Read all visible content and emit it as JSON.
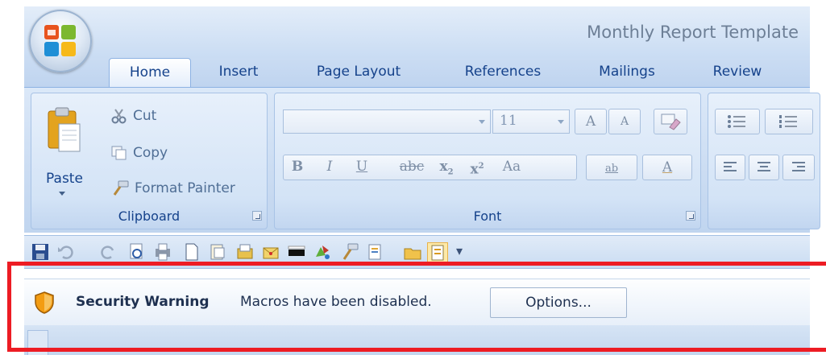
{
  "window": {
    "title": "Monthly Report Template"
  },
  "tabs": [
    {
      "label": "Home",
      "active": true
    },
    {
      "label": "Insert"
    },
    {
      "label": "Page Layout"
    },
    {
      "label": "References"
    },
    {
      "label": "Mailings"
    },
    {
      "label": "Review"
    }
  ],
  "clipboard": {
    "paste_label": "Paste",
    "cut_label": "Cut",
    "copy_label": "Copy",
    "format_painter_label": "Format Painter",
    "group_label": "Clipboard"
  },
  "font": {
    "font_name": "",
    "font_size": "11",
    "group_label": "Font",
    "grow_label": "A",
    "shrink_label": "A",
    "bold_label": "B",
    "italic_label": "I",
    "underline_label": "U",
    "strike_label": "abc",
    "subscript_label": "x",
    "superscript_label": "x",
    "case_label": "Aa",
    "highlight_label": "ab",
    "color_label": "A"
  },
  "qat": {
    "icons": [
      "save-icon",
      "undo-icon",
      "redo-icon",
      "print-preview-icon",
      "print-icon",
      "new-document-icon",
      "page-icon",
      "attach-icon",
      "envelope-icon",
      "line-icon",
      "shapes-icon",
      "format-painter-icon",
      "list-icon",
      "folder-icon",
      "document-map-icon"
    ],
    "overflow_label": "▾"
  },
  "security_bar": {
    "title": "Security Warning",
    "message": "Macros have been disabled.",
    "options_label": "Options..."
  },
  "colors": {
    "accent": "#15428b",
    "highlight_border": "#ed1c24",
    "shield": "#f39c12"
  }
}
